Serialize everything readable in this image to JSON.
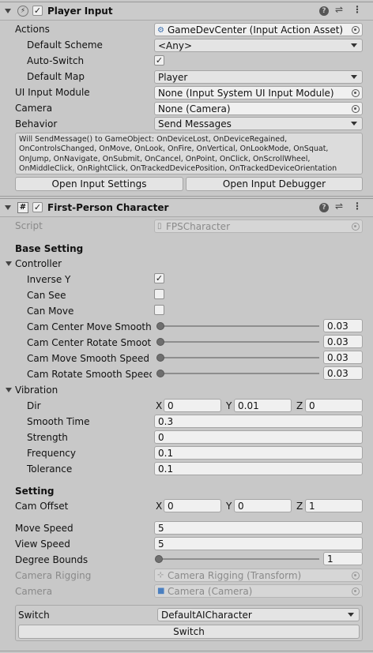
{
  "player_input": {
    "title": "Player Input",
    "icons": {
      "component": "lightning-icon",
      "help": "help-icon",
      "presets": "sliders-icon",
      "menu": "kebab-menu-icon"
    },
    "actions": {
      "label": "Actions",
      "value": "GameDevCenter (Input Action Asset)"
    },
    "default_scheme": {
      "label": "Default Scheme",
      "value": "<Any>"
    },
    "auto_switch": {
      "label": "Auto-Switch",
      "checked": true
    },
    "default_map": {
      "label": "Default Map",
      "value": "Player"
    },
    "ui_input_module": {
      "label": "UI Input Module",
      "value": "None (Input System UI Input Module)"
    },
    "camera": {
      "label": "Camera",
      "value": "None (Camera)"
    },
    "behavior": {
      "label": "Behavior",
      "value": "Send Messages"
    },
    "help_text": "Will SendMessage() to GameObject: OnDeviceLost, OnDeviceRegained, OnControlsChanged, OnMove, OnLook, OnFire, OnVertical, OnLookMode, OnSquat, OnJump, OnNavigate, OnSubmit, OnCancel, OnPoint, OnClick, OnScrollWheel, OnMiddleClick, OnRightClick, OnTrackedDevicePosition, OnTrackedDeviceOrientation",
    "open_settings_button": "Open Input Settings",
    "open_debugger_button": "Open Input Debugger"
  },
  "fps_character": {
    "title": "First-Person Character",
    "script": {
      "label": "Script",
      "value": "FPSCharacter"
    },
    "base_setting": "Base Setting",
    "controller": {
      "label": "Controller",
      "inverse_y": {
        "label": "Inverse Y",
        "checked": true
      },
      "can_see": {
        "label": "Can See",
        "checked": false
      },
      "can_move": {
        "label": "Can Move",
        "checked": false
      },
      "sliders": [
        {
          "label": "Cam Center Move Smooth S",
          "value": "0.03",
          "fraction": 0.03
        },
        {
          "label": "Cam Center Rotate Smooth S",
          "value": "0.03",
          "fraction": 0.03
        },
        {
          "label": "Cam Move Smooth Speed",
          "value": "0.03",
          "fraction": 0.03
        },
        {
          "label": "Cam Rotate Smooth Speed",
          "value": "0.03",
          "fraction": 0.03
        }
      ]
    },
    "vibration": {
      "label": "Vibration",
      "dir": {
        "label": "Dir",
        "x_label": "X",
        "x": "0",
        "y_label": "Y",
        "y": "0.01",
        "z_label": "Z",
        "z": "0"
      },
      "smooth_time": {
        "label": "Smooth Time",
        "value": "0.3"
      },
      "strength": {
        "label": "Strength",
        "value": "0"
      },
      "frequency": {
        "label": "Frequency",
        "value": "0.1"
      },
      "tolerance": {
        "label": "Tolerance",
        "value": "0.1"
      }
    },
    "setting": {
      "label": "Setting",
      "cam_offset": {
        "label": "Cam Offset",
        "x_label": "X",
        "x": "0",
        "y_label": "Y",
        "y": "0",
        "z_label": "Z",
        "z": "1"
      },
      "move_speed": {
        "label": "Move Speed",
        "value": "5"
      },
      "view_speed": {
        "label": "View Speed",
        "value": "5"
      },
      "degree_bounds": {
        "label": "Degree Bounds",
        "value": "1",
        "fraction": 0.0
      },
      "camera_rigging": {
        "label": "Camera Rigging",
        "value": "Camera Rigging (Transform)"
      },
      "camera": {
        "label": "Camera",
        "value": "Camera (Camera)"
      }
    },
    "switch": {
      "label": "Switch",
      "value": "DefaultAICharacter",
      "button": "Switch"
    }
  }
}
